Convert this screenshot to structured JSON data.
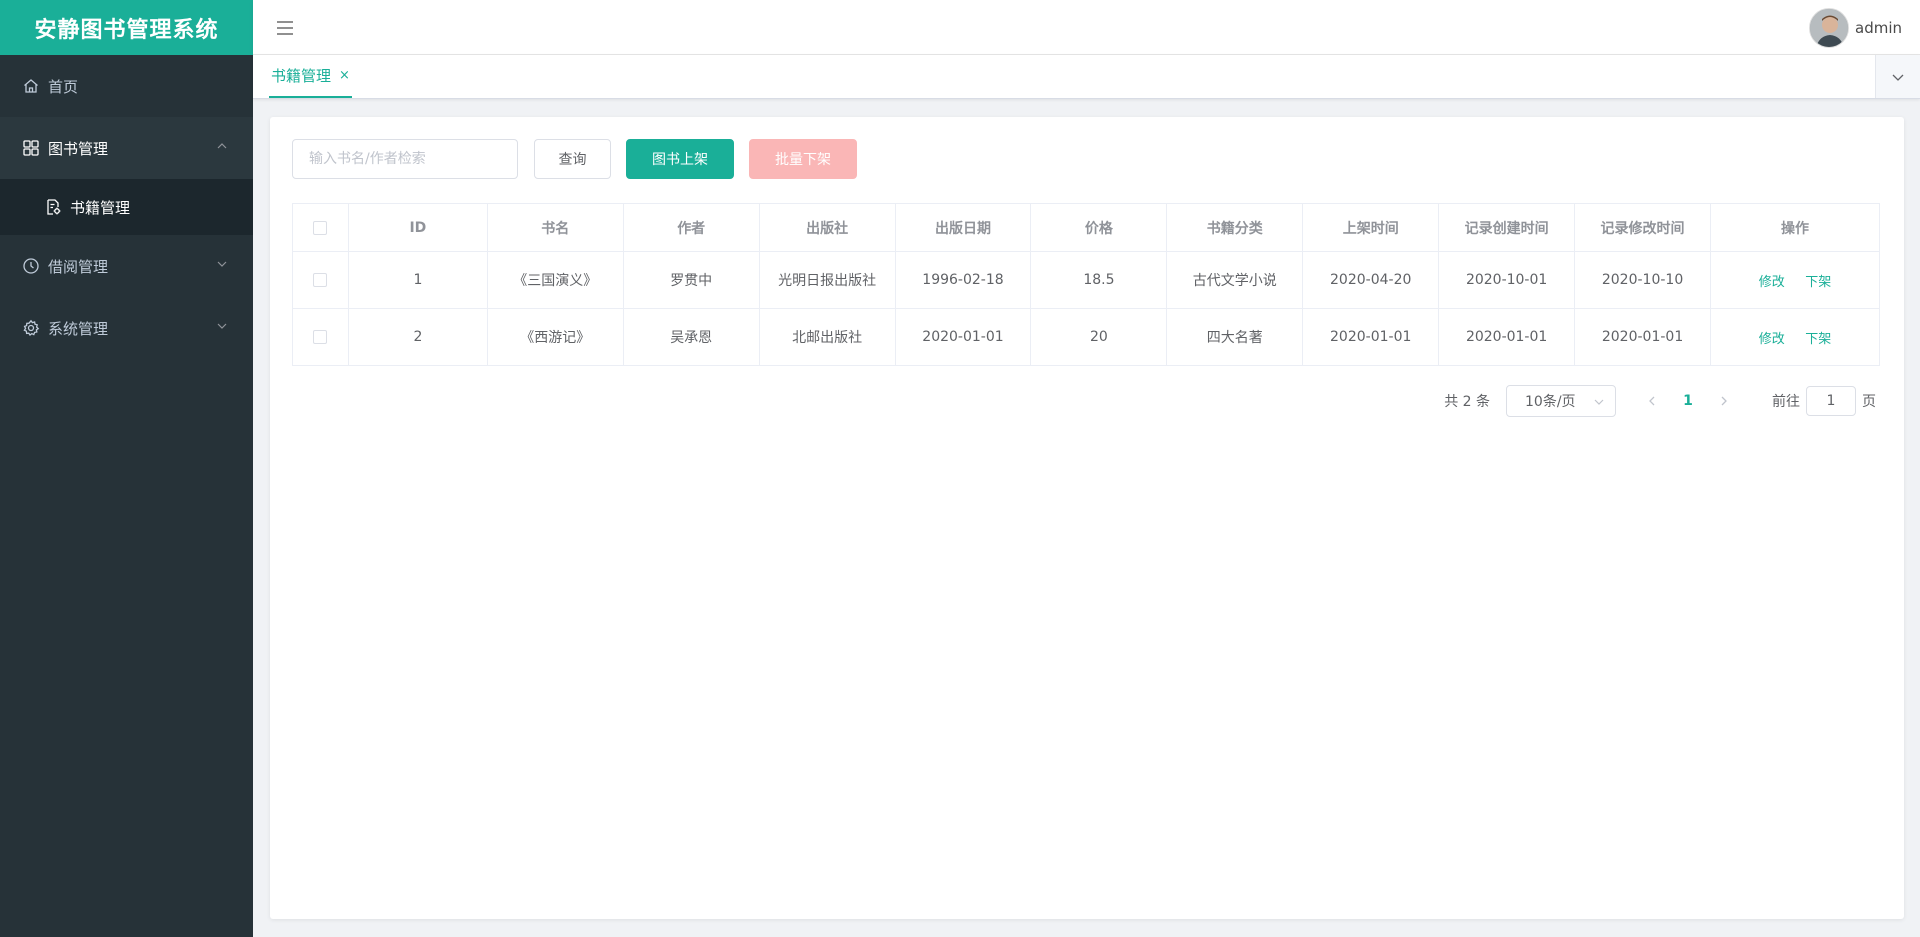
{
  "app": {
    "title": "安静图书管理系统"
  },
  "sidebar": {
    "items": [
      {
        "label": "首页",
        "icon": "home-icon"
      },
      {
        "label": "图书管理",
        "icon": "grid-icon",
        "expanded": true,
        "children": [
          {
            "label": "书籍管理",
            "icon": "document-settings-icon"
          }
        ]
      },
      {
        "label": "借阅管理",
        "icon": "clock-icon"
      },
      {
        "label": "系统管理",
        "icon": "gear-icon"
      }
    ]
  },
  "header": {
    "username": "admin"
  },
  "tabs": [
    {
      "label": "书籍管理",
      "close": "×"
    }
  ],
  "toolbar": {
    "search_placeholder": "输入书名/作者检索",
    "query_label": "查询",
    "add_label": "图书上架",
    "batch_label": "批量下架"
  },
  "table": {
    "columns": [
      "ID",
      "书名",
      "作者",
      "出版社",
      "出版日期",
      "价格",
      "书籍分类",
      "上架时间",
      "记录创建时间",
      "记录修改时间",
      "操作"
    ],
    "rows": [
      {
        "id": "1",
        "name": "《三国演义》",
        "author": "罗贯中",
        "publisher": "光明日报出版社",
        "pub_date": "1996-02-18",
        "price": "18.5",
        "category": "古代文学小说",
        "shelf_time": "2020-04-20",
        "created": "2020-10-01",
        "modified": "2020-10-10",
        "edit": "修改",
        "remove": "下架"
      },
      {
        "id": "2",
        "name": "《西游记》",
        "author": "吴承恩",
        "publisher": "北邮出版社",
        "pub_date": "2020-01-01",
        "price": "20",
        "category": "四大名著",
        "shelf_time": "2020-01-01",
        "created": "2020-01-01",
        "modified": "2020-01-01",
        "edit": "修改",
        "remove": "下架"
      }
    ]
  },
  "pagination": {
    "total": "共 2 条",
    "page_size": "10条/页",
    "current_page": "1",
    "goto_prefix": "前往",
    "goto_value": "1",
    "goto_suffix": "页"
  },
  "colors": {
    "brand": "#1aaf98",
    "sidebar_bg": "#263238",
    "danger_light": "#fab6b6"
  }
}
